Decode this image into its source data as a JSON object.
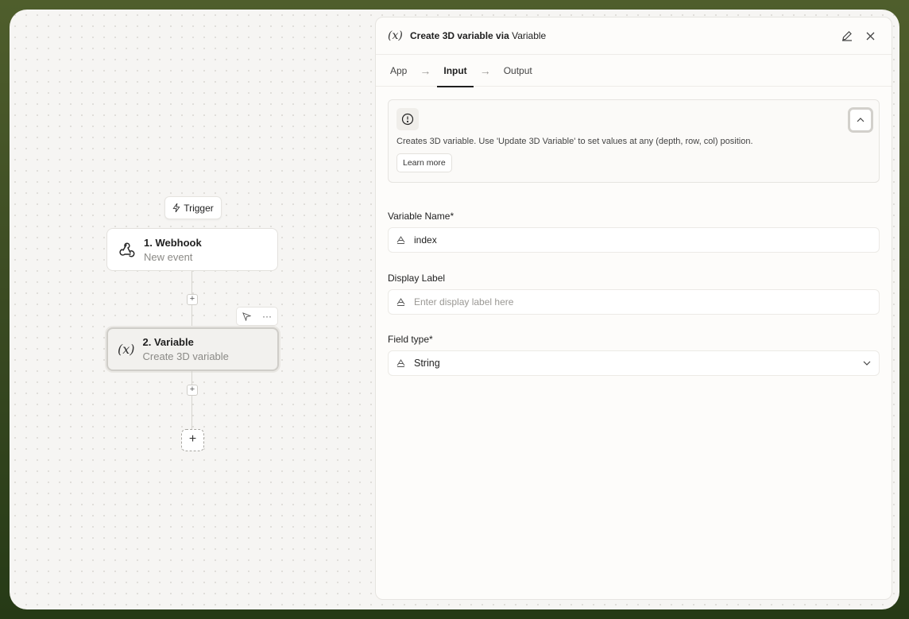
{
  "canvas": {
    "trigger_label": "Trigger",
    "nodes": [
      {
        "title": "1. Webhook",
        "subtitle": "New event"
      },
      {
        "title": "2. Variable",
        "subtitle": "Create 3D variable"
      }
    ],
    "node_tools": {
      "more": "···"
    },
    "add_step": "+"
  },
  "panel": {
    "fx_symbol": "(x)",
    "title_prefix": "Create 3D variable via",
    "title_app": "Variable",
    "tabs": [
      {
        "label": "App"
      },
      {
        "label": "Input"
      },
      {
        "label": "Output"
      }
    ],
    "info": {
      "text": "Creates 3D variable. Use 'Update 3D Variable' to set values at any (depth, row, col) position.",
      "learn_more": "Learn more"
    },
    "fields": {
      "variable_name": {
        "label": "Variable Name*",
        "value": "index"
      },
      "display_label": {
        "label": "Display Label",
        "placeholder": "Enter display label here"
      },
      "field_type": {
        "label": "Field type*",
        "value": "String"
      }
    }
  }
}
